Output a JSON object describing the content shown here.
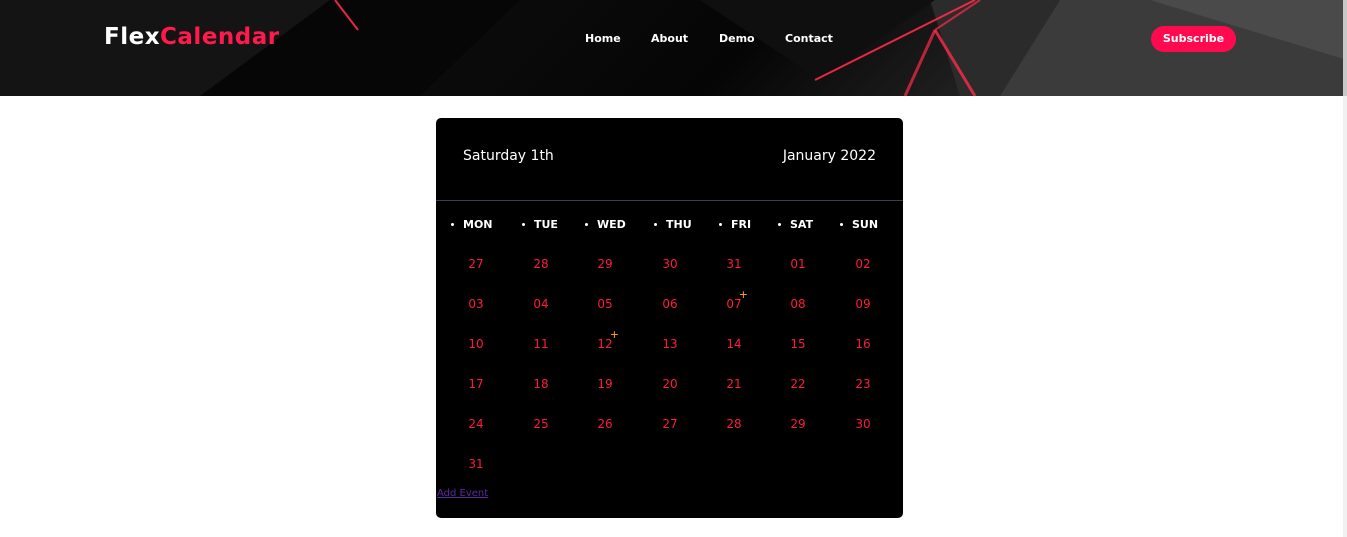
{
  "header": {
    "logo_part1": "Flex",
    "logo_part2": "Calendar",
    "nav": [
      "Home",
      "About",
      "Demo",
      "Contact"
    ],
    "subscribe_label": "Subscribe"
  },
  "calendar": {
    "selected_day_label": "Saturday 1th",
    "month_label": "January 2022",
    "weekdays": [
      "MON",
      "TUE",
      "WED",
      "THU",
      "FRI",
      "SAT",
      "SUN"
    ],
    "weeks": [
      [
        "27",
        "28",
        "29",
        "30",
        "31",
        "01",
        "02"
      ],
      [
        "03",
        "04",
        "05",
        "06",
        "07",
        "08",
        "09"
      ],
      [
        "10",
        "11",
        "12",
        "13",
        "14",
        "15",
        "16"
      ],
      [
        "17",
        "18",
        "19",
        "20",
        "21",
        "22",
        "23"
      ],
      [
        "24",
        "25",
        "26",
        "27",
        "28",
        "29",
        "30"
      ],
      [
        "31"
      ]
    ],
    "event_marker": "+",
    "event_days": [
      "07",
      "12"
    ],
    "add_event_label": "Add Event"
  },
  "colors": {
    "accent": "#ff0a4f",
    "day_number": "#ff1a3c",
    "event_marker": "#ffb000",
    "card_bg": "#000000"
  }
}
